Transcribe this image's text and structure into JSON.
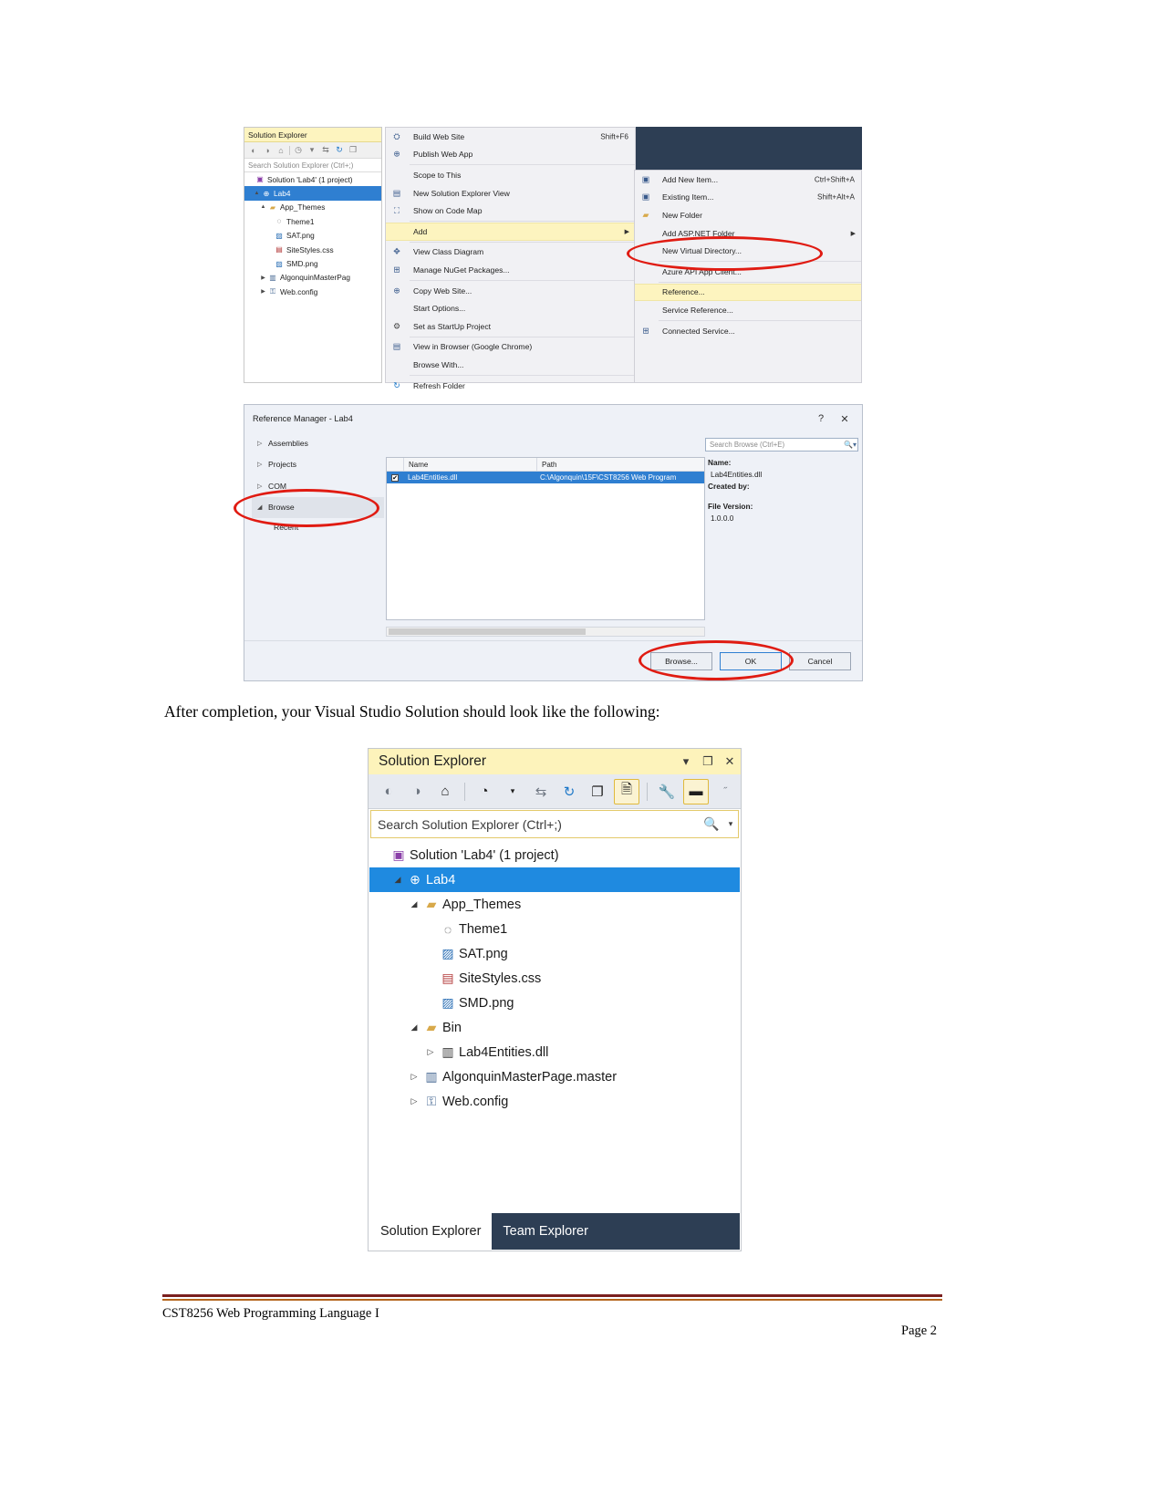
{
  "figure1": {
    "solution_explorer": {
      "title": "Solution Explorer",
      "search_placeholder": "Search Solution Explorer (Ctrl+;)",
      "toolbar_icons": [
        "back-icon",
        "forward-icon",
        "home-icon",
        "pending-changes-icon",
        "dropdown-icon",
        "sync-icon",
        "refresh-icon",
        "collapse-all-icon",
        "properties-icon"
      ],
      "tree": [
        {
          "label": "Solution 'Lab4' (1 project)",
          "icon": "solution-icon",
          "indent": 0,
          "twisty": "",
          "selected": false
        },
        {
          "label": "Lab4",
          "icon": "web-site-icon",
          "indent": 1,
          "twisty": "▲",
          "selected": true
        },
        {
          "label": "App_Themes",
          "icon": "folder-icon",
          "indent": 2,
          "twisty": "▲",
          "selected": false
        },
        {
          "label": "Theme1",
          "icon": "theme-icon",
          "indent": 3,
          "twisty": "",
          "selected": false
        },
        {
          "label": "SAT.png",
          "icon": "image-file-icon",
          "indent": 3,
          "twisty": "",
          "selected": false
        },
        {
          "label": "SiteStyles.css",
          "icon": "css-file-icon",
          "indent": 3,
          "twisty": "",
          "selected": false
        },
        {
          "label": "SMD.png",
          "icon": "image-file-icon",
          "indent": 3,
          "twisty": "",
          "selected": false
        },
        {
          "label": "AlgonquinMasterPag",
          "icon": "master-page-icon",
          "indent": 2,
          "twisty": "▶",
          "selected": false
        },
        {
          "label": "Web.config",
          "icon": "config-file-icon",
          "indent": 2,
          "twisty": "▶",
          "selected": false
        }
      ]
    },
    "context_menu": [
      {
        "label": "Build Web Site",
        "shortcut": "Shift+F6",
        "icon": "build-icon",
        "highlight": false,
        "submenu": false,
        "sep_after": false
      },
      {
        "label": "Publish Web App",
        "shortcut": "",
        "icon": "publish-icon",
        "highlight": false,
        "submenu": false,
        "sep_after": true
      },
      {
        "label": "Scope to This",
        "shortcut": "",
        "icon": "",
        "highlight": false,
        "submenu": false,
        "sep_after": false
      },
      {
        "label": "New Solution Explorer View",
        "shortcut": "",
        "icon": "new-view-icon",
        "highlight": false,
        "submenu": false,
        "sep_after": false
      },
      {
        "label": "Show on Code Map",
        "shortcut": "",
        "icon": "code-map-icon",
        "highlight": false,
        "submenu": false,
        "sep_after": true
      },
      {
        "label": "Add",
        "shortcut": "",
        "icon": "",
        "highlight": true,
        "submenu": true,
        "sep_after": true
      },
      {
        "label": "View Class Diagram",
        "shortcut": "",
        "icon": "class-diagram-icon",
        "highlight": false,
        "submenu": false,
        "sep_after": false
      },
      {
        "label": "Manage NuGet Packages...",
        "shortcut": "",
        "icon": "nuget-icon",
        "highlight": false,
        "submenu": false,
        "sep_after": true
      },
      {
        "label": "Copy Web Site...",
        "shortcut": "",
        "icon": "copy-web-site-icon",
        "highlight": false,
        "submenu": false,
        "sep_after": false
      },
      {
        "label": "Start Options...",
        "shortcut": "",
        "icon": "",
        "highlight": false,
        "submenu": false,
        "sep_after": false
      },
      {
        "label": "Set as StartUp Project",
        "shortcut": "",
        "icon": "gear-icon",
        "highlight": false,
        "submenu": false,
        "sep_after": true
      },
      {
        "label": "View in Browser (Google Chrome)",
        "shortcut": "",
        "icon": "browser-icon",
        "highlight": false,
        "submenu": false,
        "sep_after": false
      },
      {
        "label": "Browse With...",
        "shortcut": "",
        "icon": "",
        "highlight": false,
        "submenu": false,
        "sep_after": true
      },
      {
        "label": "Refresh Folder",
        "shortcut": "",
        "icon": "refresh-icon",
        "highlight": false,
        "submenu": false,
        "sep_after": false
      }
    ],
    "submenu": [
      {
        "label": "Add New Item...",
        "shortcut": "Ctrl+Shift+A",
        "icon": "new-item-icon",
        "highlight": false,
        "submenu": false,
        "sep_after": false
      },
      {
        "label": "Existing Item...",
        "shortcut": "Shift+Alt+A",
        "icon": "existing-item-icon",
        "highlight": false,
        "submenu": false,
        "sep_after": false
      },
      {
        "label": "New Folder",
        "shortcut": "",
        "icon": "new-folder-icon",
        "highlight": false,
        "submenu": false,
        "sep_after": false
      },
      {
        "label": "Add ASP.NET Folder",
        "shortcut": "",
        "icon": "",
        "highlight": false,
        "submenu": true,
        "sep_after": false
      },
      {
        "label": "New Virtual Directory...",
        "shortcut": "",
        "icon": "",
        "highlight": false,
        "submenu": false,
        "sep_after": true
      },
      {
        "label": "Azure API App Client...",
        "shortcut": "",
        "icon": "",
        "highlight": false,
        "submenu": false,
        "sep_after": true
      },
      {
        "label": "Reference...",
        "shortcut": "",
        "icon": "",
        "highlight": true,
        "submenu": false,
        "sep_after": false
      },
      {
        "label": "Service Reference...",
        "shortcut": "",
        "icon": "",
        "highlight": false,
        "submenu": false,
        "sep_after": true
      },
      {
        "label": "Connected Service...",
        "shortcut": "",
        "icon": "connected-service-icon",
        "highlight": false,
        "submenu": false,
        "sep_after": false
      }
    ],
    "annotation_color": "#e01b12"
  },
  "figure2": {
    "title": "Reference Manager - Lab4",
    "help_glyph": "?",
    "close_glyph": "✕",
    "categories": [
      {
        "label": "Assemblies",
        "twisty": "▷",
        "open": false
      },
      {
        "label": "Projects",
        "twisty": "▷",
        "open": false
      },
      {
        "label": "COM",
        "twisty": "▷",
        "open": false
      },
      {
        "label": "Browse",
        "twisty": "◢",
        "open": true
      }
    ],
    "sub_item": "Recent",
    "search_placeholder": "Search Browse (Ctrl+E)",
    "columns": [
      "Name",
      "Path"
    ],
    "rows": [
      {
        "checked": true,
        "name": "Lab4Entities.dll",
        "path": "C:\\Algonquin\\15F\\CST8256 Web Program"
      }
    ],
    "detail": {
      "name_label": "Name:",
      "name_value": "Lab4Entities.dll",
      "created_label": "Created by:",
      "created_value": "",
      "version_label": "File Version:",
      "version_value": "1.0.0.0"
    },
    "buttons": [
      {
        "label": "Browse...",
        "primary": false
      },
      {
        "label": "OK",
        "primary": true
      },
      {
        "label": "Cancel",
        "primary": false
      }
    ]
  },
  "caption": "After completion, your Visual Studio Solution should look like the following:",
  "figure3": {
    "title": "Solution Explorer",
    "window_buttons": [
      "▾",
      "❐",
      "✕"
    ],
    "toolbar_icons": [
      "back-icon",
      "forward-icon",
      "home-icon",
      "pending-changes-icon",
      "dropdown-icon",
      "sync-with-active-document-icon",
      "refresh-icon",
      "collapse-all-icon",
      "show-all-files-icon",
      "properties-icon",
      "preview-selected-items-icon"
    ],
    "search_placeholder": "Search Solution Explorer (Ctrl+;)",
    "search_glyph": "search-icon",
    "tree": [
      {
        "label": "Solution 'Lab4' (1 project)",
        "icon": "solution-icon",
        "indent": 0,
        "twisty": "",
        "selected": false
      },
      {
        "label": "Lab4",
        "icon": "web-site-icon",
        "indent": 1,
        "twisty": "◢",
        "selected": true
      },
      {
        "label": "App_Themes",
        "icon": "folder-icon",
        "indent": 2,
        "twisty": "◢",
        "selected": false
      },
      {
        "label": "Theme1",
        "icon": "theme-icon",
        "indent": 3,
        "twisty": "",
        "selected": false
      },
      {
        "label": "SAT.png",
        "icon": "image-file-icon",
        "indent": 3,
        "twisty": "",
        "selected": false
      },
      {
        "label": "SiteStyles.css",
        "icon": "css-file-icon",
        "indent": 3,
        "twisty": "",
        "selected": false
      },
      {
        "label": "SMD.png",
        "icon": "image-file-icon",
        "indent": 3,
        "twisty": "",
        "selected": false
      },
      {
        "label": "Bin",
        "icon": "folder-icon",
        "indent": 2,
        "twisty": "◢",
        "selected": false
      },
      {
        "label": "Lab4Entities.dll",
        "icon": "assembly-icon",
        "indent": 3,
        "twisty": "▷",
        "selected": false
      },
      {
        "label": "AlgonquinMasterPage.master",
        "icon": "master-page-icon",
        "indent": 2,
        "twisty": "▷",
        "selected": false
      },
      {
        "label": "Web.config",
        "icon": "config-file-icon",
        "indent": 2,
        "twisty": "▷",
        "selected": false
      }
    ],
    "tabs": [
      {
        "label": "Solution Explorer",
        "active": true
      },
      {
        "label": "Team Explorer",
        "active": false
      }
    ]
  },
  "footer": {
    "left": "CST8256 Web Programming Language I",
    "right": "Page 2",
    "rule_color": "#7b1f1f"
  }
}
